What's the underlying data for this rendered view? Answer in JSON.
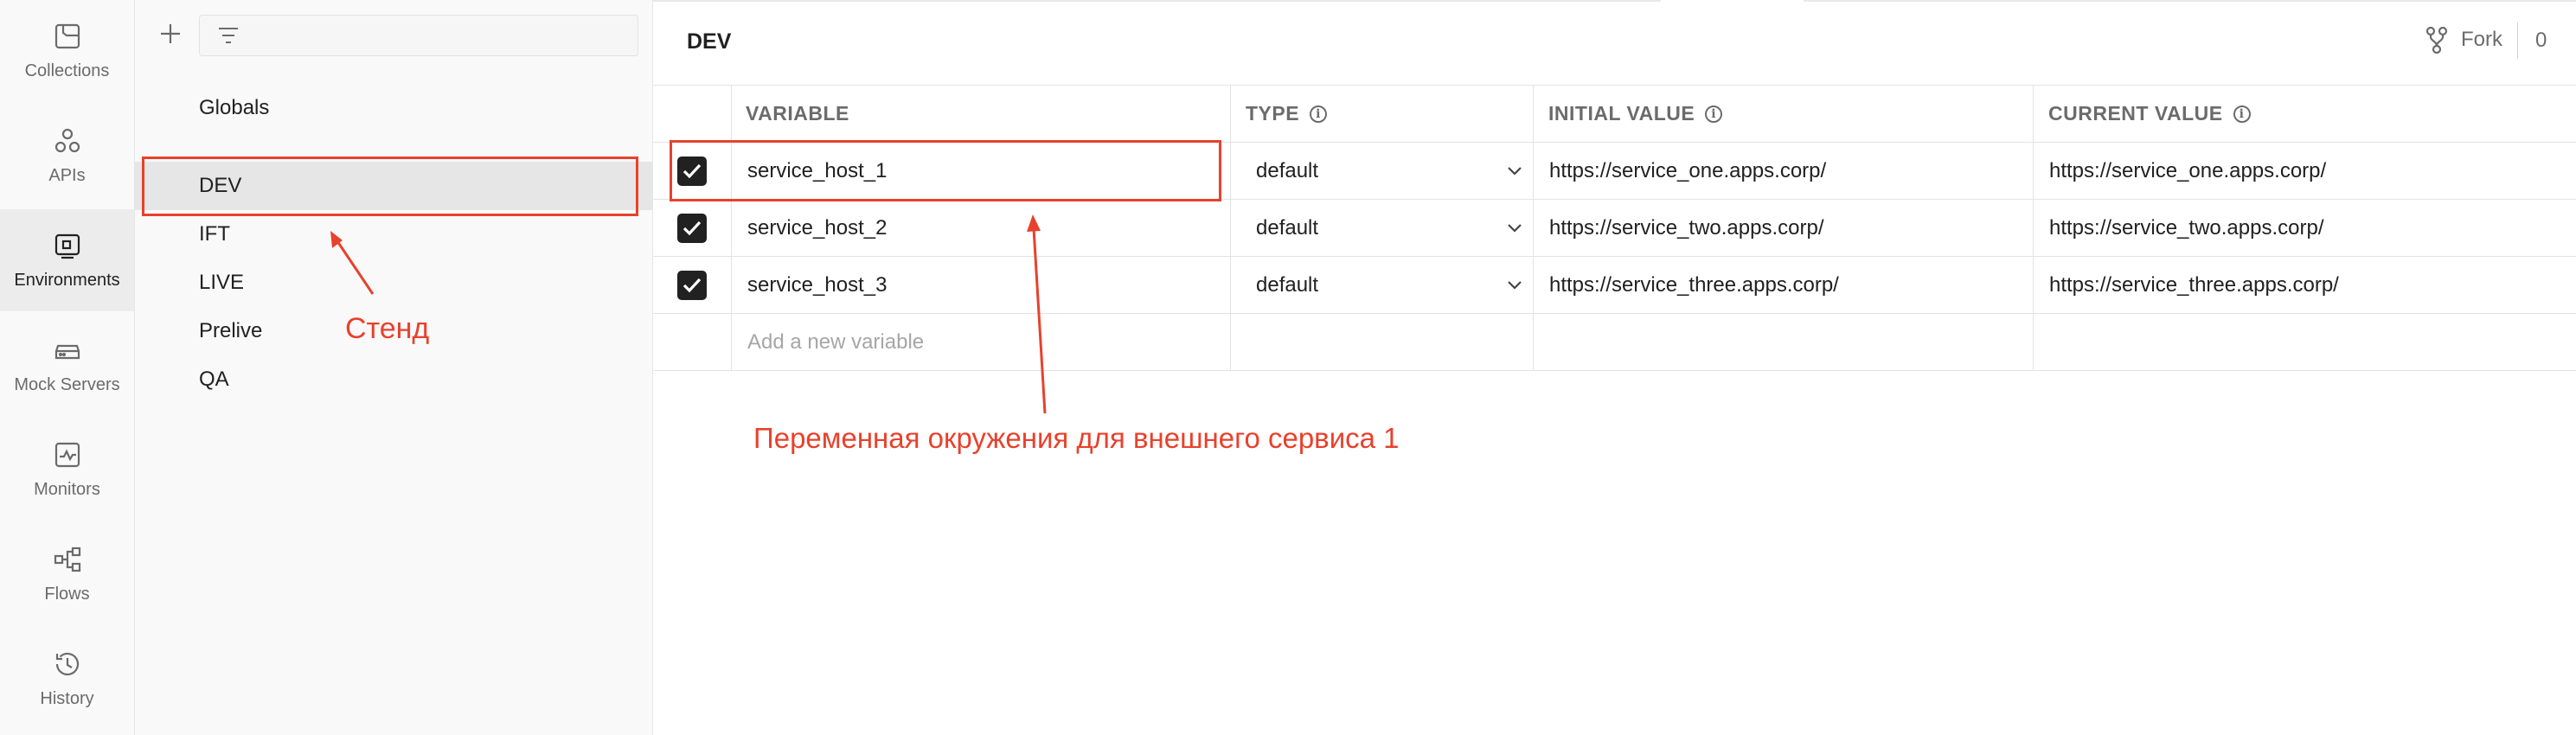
{
  "sidebar": {
    "items": [
      {
        "label": "Collections",
        "icon": "collections-icon",
        "active": false
      },
      {
        "label": "APIs",
        "icon": "apis-icon",
        "active": false
      },
      {
        "label": "Environments",
        "icon": "environments-icon",
        "active": true
      },
      {
        "label": "Mock Servers",
        "icon": "mock-servers-icon",
        "active": false
      },
      {
        "label": "Monitors",
        "icon": "monitors-icon",
        "active": false
      },
      {
        "label": "Flows",
        "icon": "flows-icon",
        "active": false
      },
      {
        "label": "History",
        "icon": "history-icon",
        "active": false
      }
    ]
  },
  "environments": {
    "globals_label": "Globals",
    "items": [
      {
        "label": "DEV",
        "selected": true
      },
      {
        "label": "IFT",
        "selected": false
      },
      {
        "label": "LIVE",
        "selected": false
      },
      {
        "label": "Prelive",
        "selected": false
      },
      {
        "label": "QA",
        "selected": false
      }
    ]
  },
  "header": {
    "title": "DEV",
    "fork_label": "Fork",
    "fork_count": "0"
  },
  "table": {
    "columns": {
      "variable": "VARIABLE",
      "type": "TYPE",
      "initial": "INITIAL VALUE",
      "current": "CURRENT VALUE"
    },
    "rows": [
      {
        "checked": true,
        "variable": "service_host_1",
        "type": "default",
        "initial": "https://service_one.apps.corp/",
        "current": "https://service_one.apps.corp/"
      },
      {
        "checked": true,
        "variable": "service_host_2",
        "type": "default",
        "initial": "https://service_two.apps.corp/",
        "current": "https://service_two.apps.corp/"
      },
      {
        "checked": true,
        "variable": "service_host_3",
        "type": "default",
        "initial": "https://service_three.apps.corp/",
        "current": "https://service_three.apps.corp/"
      }
    ],
    "add_placeholder": "Add a new variable"
  },
  "annotations": {
    "stand": "Стенд",
    "variable_note": "Переменная окружения для внешнего сервиса 1",
    "color": "#e8412c"
  }
}
